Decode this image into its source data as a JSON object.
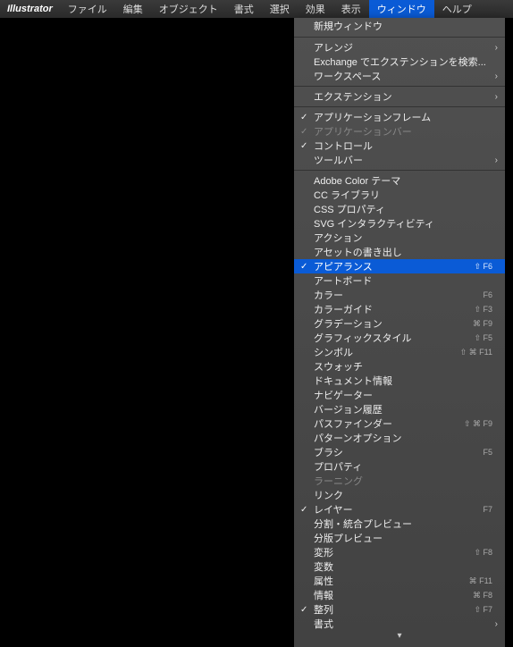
{
  "menubar": {
    "logo": "Illustrator",
    "items": [
      "ファイル",
      "編集",
      "オブジェクト",
      "書式",
      "選択",
      "効果",
      "表示",
      "ウィンドウ",
      "ヘルプ"
    ],
    "active_index": 7
  },
  "dropdown": {
    "groups": [
      [
        {
          "label": "新規ウィンドウ"
        }
      ],
      [
        {
          "label": "アレンジ",
          "submenu": true
        },
        {
          "label": "Exchange でエクステンションを検索..."
        },
        {
          "label": "ワークスペース",
          "submenu": true
        }
      ],
      [
        {
          "label": "エクステンション",
          "submenu": true
        }
      ],
      [
        {
          "label": "アプリケーションフレーム",
          "checked": true
        },
        {
          "label": "アプリケーションバー",
          "checked": true,
          "disabled": true
        },
        {
          "label": "コントロール",
          "checked": true
        },
        {
          "label": "ツールバー",
          "submenu": true
        }
      ],
      [
        {
          "label": "Adobe Color テーマ"
        },
        {
          "label": "CC ライブラリ"
        },
        {
          "label": "CSS プロパティ"
        },
        {
          "label": "SVG インタラクティビティ"
        },
        {
          "label": "アクション"
        },
        {
          "label": "アセットの書き出し"
        },
        {
          "label": "アピアランス",
          "checked": true,
          "highlight": true,
          "shortcut": "⇧ F6"
        },
        {
          "label": "アートボード"
        },
        {
          "label": "カラー",
          "shortcut": "F6"
        },
        {
          "label": "カラーガイド",
          "shortcut": "⇧ F3"
        },
        {
          "label": "グラデーション",
          "shortcut": "⌘ F9"
        },
        {
          "label": "グラフィックスタイル",
          "shortcut": "⇧ F5"
        },
        {
          "label": "シンボル",
          "shortcut": "⇧ ⌘ F11"
        },
        {
          "label": "スウォッチ"
        },
        {
          "label": "ドキュメント情報"
        },
        {
          "label": "ナビゲーター"
        },
        {
          "label": "バージョン履歴"
        },
        {
          "label": "パスファインダー",
          "shortcut": "⇧ ⌘ F9"
        },
        {
          "label": "パターンオプション"
        },
        {
          "label": "ブラシ",
          "shortcut": "F5"
        },
        {
          "label": "プロパティ"
        },
        {
          "label": "ラーニング",
          "disabled": true
        },
        {
          "label": "リンク"
        },
        {
          "label": "レイヤー",
          "checked": true,
          "shortcut": "F7"
        },
        {
          "label": "分割・統合プレビュー"
        },
        {
          "label": "分版プレビュー"
        },
        {
          "label": "変形",
          "shortcut": "⇧ F8"
        },
        {
          "label": "変数"
        },
        {
          "label": "属性",
          "shortcut": "⌘ F11"
        },
        {
          "label": "情報",
          "shortcut": "⌘ F8"
        },
        {
          "label": "整列",
          "checked": true,
          "shortcut": "⇧ F7"
        },
        {
          "label": "書式",
          "submenu": true
        }
      ]
    ],
    "scroll_more": "▾"
  }
}
